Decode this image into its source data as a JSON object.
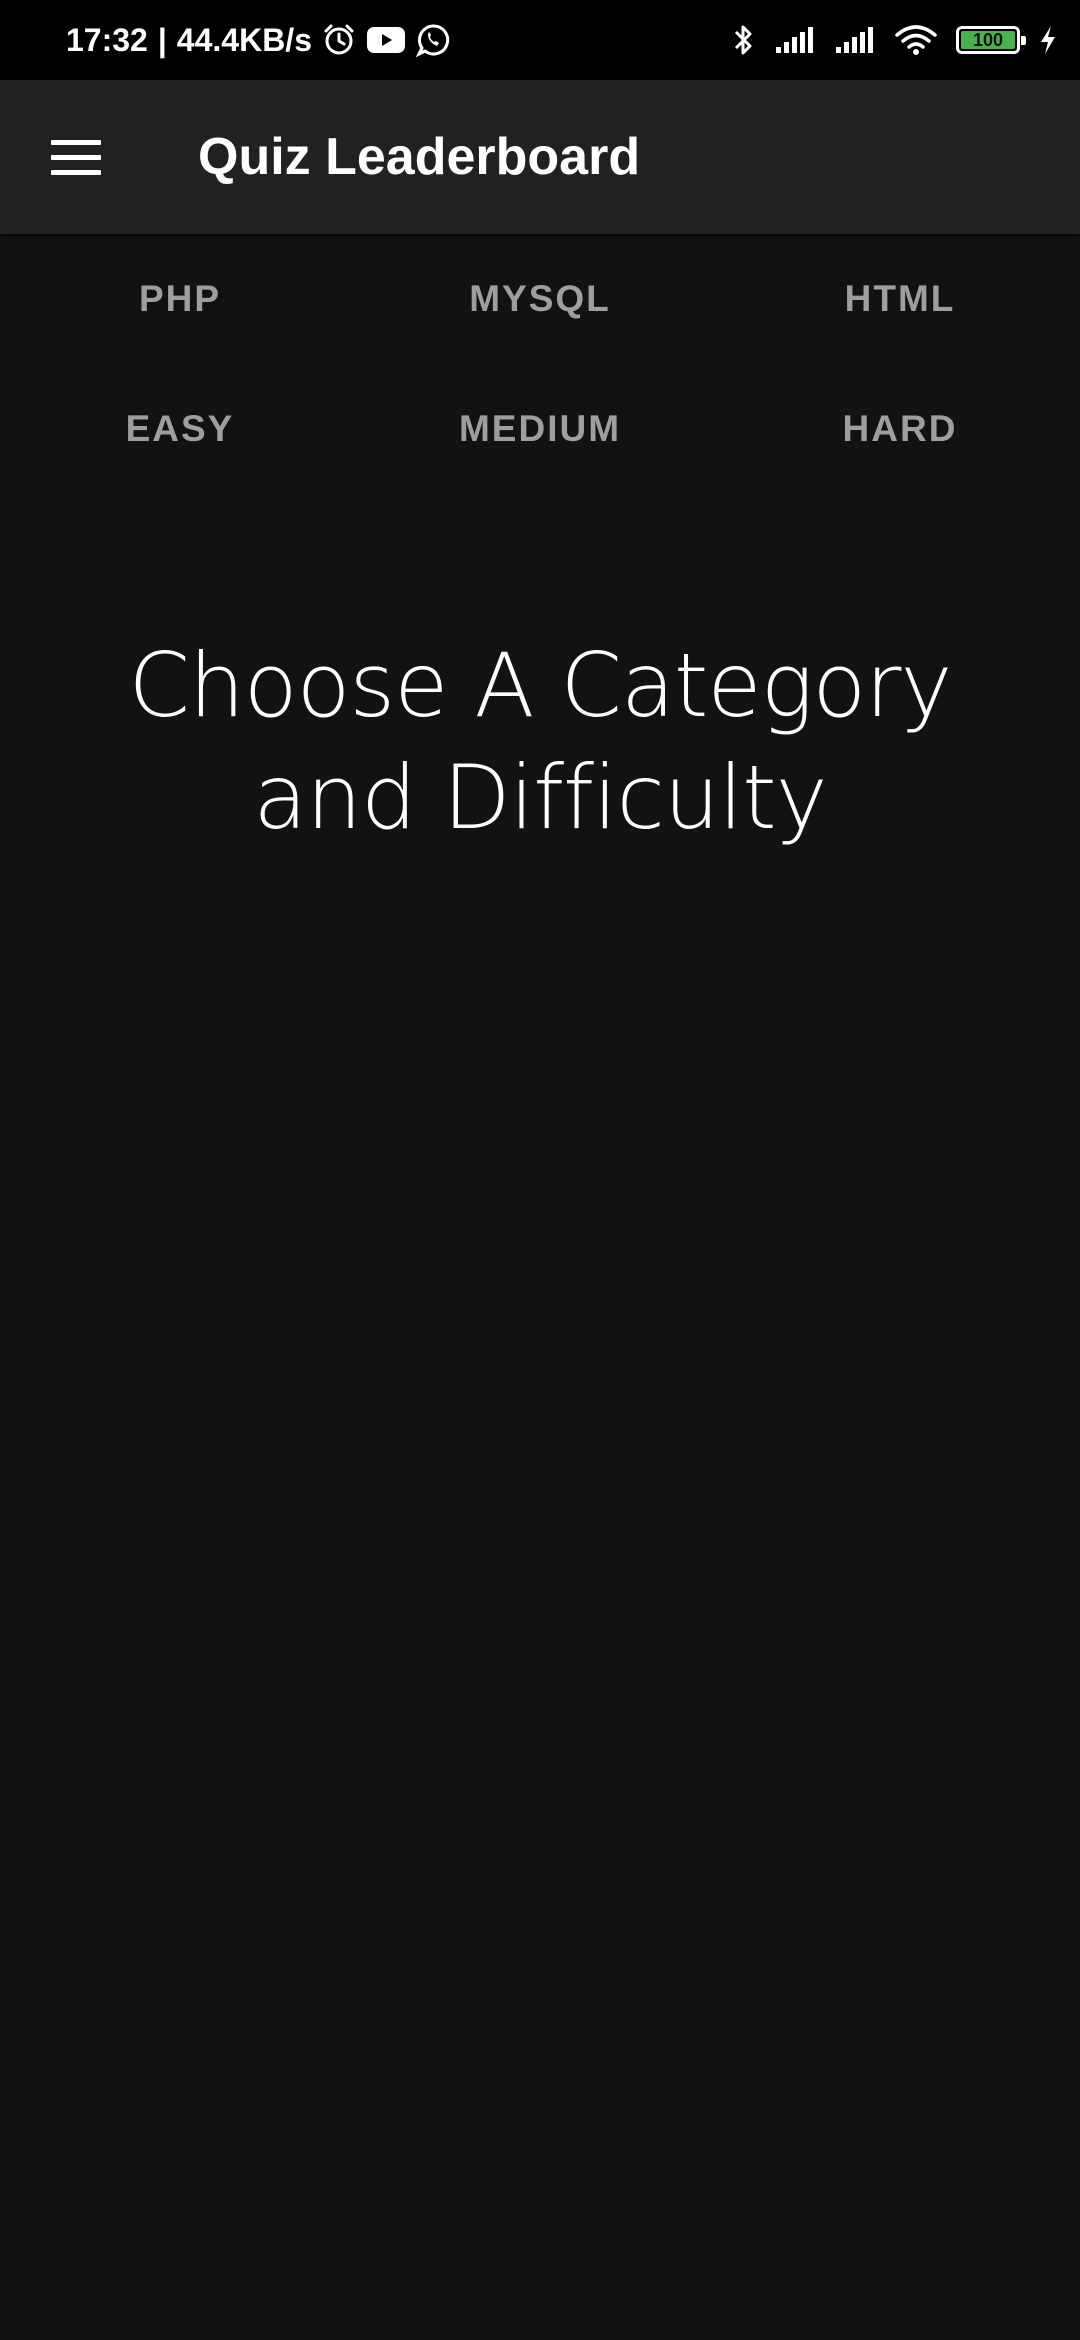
{
  "status_bar": {
    "time": "17:32",
    "separator": "|",
    "network_speed": "44.4KB/s",
    "battery_level": "100",
    "battery_fraction": 1.0,
    "icons_left": [
      "alarm-icon",
      "youtube-icon",
      "whatsapp-icon"
    ],
    "icons_right": [
      "bluetooth-icon",
      "signal-icon",
      "signal-icon",
      "wifi-icon",
      "battery-icon",
      "charging-icon"
    ]
  },
  "app_bar": {
    "title": "Quiz Leaderboard",
    "menu_icon": "hamburger-menu-icon"
  },
  "categories": [
    {
      "label": "PHP"
    },
    {
      "label": "MYSQL"
    },
    {
      "label": "HTML"
    }
  ],
  "difficulties": [
    {
      "label": "EASY"
    },
    {
      "label": "MEDIUM"
    },
    {
      "label": "HARD"
    }
  ],
  "prompt": {
    "text": "Choose A Category and Difficulty"
  },
  "colors": {
    "background": "#121212",
    "status_bar": "#000000",
    "app_bar": "#212121",
    "option_text": "#9e9e9e",
    "primary_text": "#ffffff",
    "battery_fill": "#4caf50"
  }
}
